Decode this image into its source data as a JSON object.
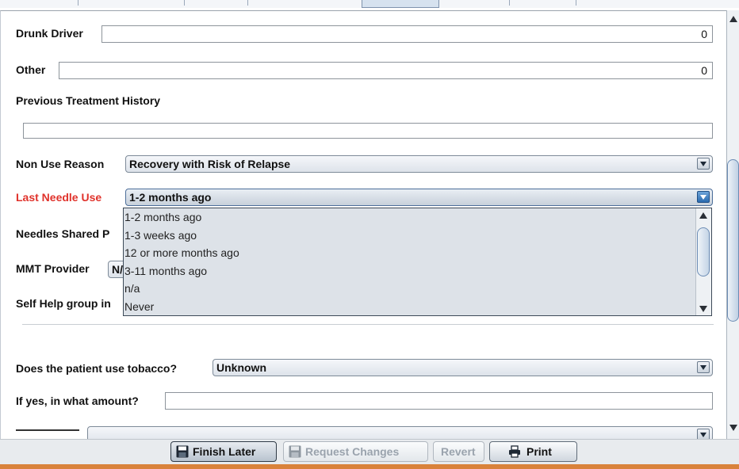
{
  "form": {
    "drunk_driver": {
      "label": "Drunk Driver",
      "value": "0"
    },
    "other": {
      "label": "Other",
      "value": "0"
    },
    "previous_treatment": {
      "label": "Previous Treatment History",
      "value": ""
    },
    "non_use_reason": {
      "label": "Non Use Reason",
      "value": "Recovery with Risk of Relapse"
    },
    "last_needle_use": {
      "label": "Last Needle Use",
      "value": "1-2 months ago",
      "options": [
        "1-2 months ago",
        "1-3 weeks ago",
        "12 or more months ago",
        "3-11 months ago",
        "n/a",
        "Never"
      ]
    },
    "needles_shared": {
      "label": "Needles Shared P"
    },
    "mmt_provider": {
      "label": "MMT Provider",
      "value": "N/"
    },
    "self_help": {
      "label": "Self Help group in"
    },
    "tobacco": {
      "label": "Does the patient use tobacco?",
      "value": "Unknown"
    },
    "tobacco_amount": {
      "label": "If yes, in what amount?",
      "value": ""
    }
  },
  "buttons": {
    "finish_later": "Finish Later",
    "request_changes": "Request Changes",
    "revert": "Revert",
    "print": "Print"
  },
  "colors": {
    "required_label": "#e0322b",
    "accent": "#2a6bb0",
    "footer_strip": "#d9823b"
  }
}
